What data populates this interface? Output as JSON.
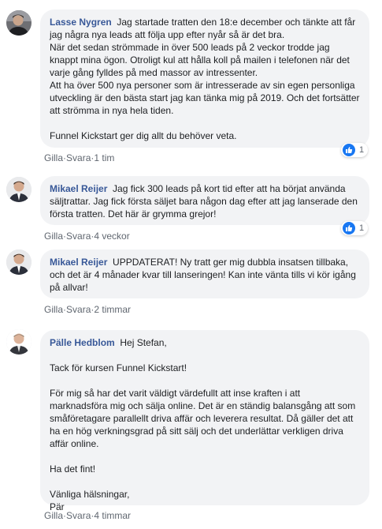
{
  "comments": [
    {
      "author": "Lasse Nygren",
      "text": "Jag startade tratten den 18:e december och tänkte att får jag några nya leads att följa upp efter nyår så är det bra.\nNär det sedan strömmade in över 500 leads på 2 veckor trodde jag knappt mina ögon. Otroligt kul att hålla koll på mailen i telefonen när det varje gång fylldes på med massor av intressenter.\nAtt ha över 500 nya personer som är intresserade av sin egen personliga utveckling är den bästa start jag kan tänka mig på 2019. Och det fortsätter att strömma in nya hela tiden.\n\nFunnel Kickstart ger dig allt du behöver veta.",
      "like_label": "Gilla",
      "reply_label": "Svara",
      "time": "1 tim",
      "reaction_count": "1",
      "reaction_icon": "like-icon"
    },
    {
      "author": "Mikael Reijer",
      "text": "Jag fick 300 leads på kort tid efter att ha börjat använda säljtrattar. Jag fick första säljet bara någon dag efter att jag lanserade den första tratten. Det här är grymma grejor!",
      "like_label": "Gilla",
      "reply_label": "Svara",
      "time": "4 veckor",
      "reaction_count": "1",
      "reaction_icon": "like-icon"
    },
    {
      "author": "Mikael Reijer",
      "text": "UPPDATERAT! Ny tratt ger mig dubbla insatsen tillbaka, och det är 4 månader kvar till lanseringen! Kan inte vänta tills vi kör igång på allvar!",
      "like_label": "Gilla",
      "reply_label": "Svara",
      "time": "2 timmar"
    },
    {
      "author": "Pälle Hedblom",
      "text": "Hej Stefan,\n\nTack för kursen Funnel Kickstart!\n\nFör mig så har det varit väldigt värdefullt att inse kraften i att marknadsföra mig och sälja online. Det är en ständig balansgång att som småföretagare parallellt driva affär och leverera resultat. Då gäller det att ha en hög verkningsgrad på sitt sälj och det underlättar verkligen driva affär online.\n\nHa det fint!\n\nVänliga hälsningar,\nPär",
      "like_label": "Gilla",
      "reply_label": "Svara",
      "time": "4 timmar"
    }
  ],
  "separator": "·",
  "colors": {
    "author": "#385898",
    "bubble": "#f2f3f5",
    "meta": "#606770",
    "like": "#1877f2"
  }
}
